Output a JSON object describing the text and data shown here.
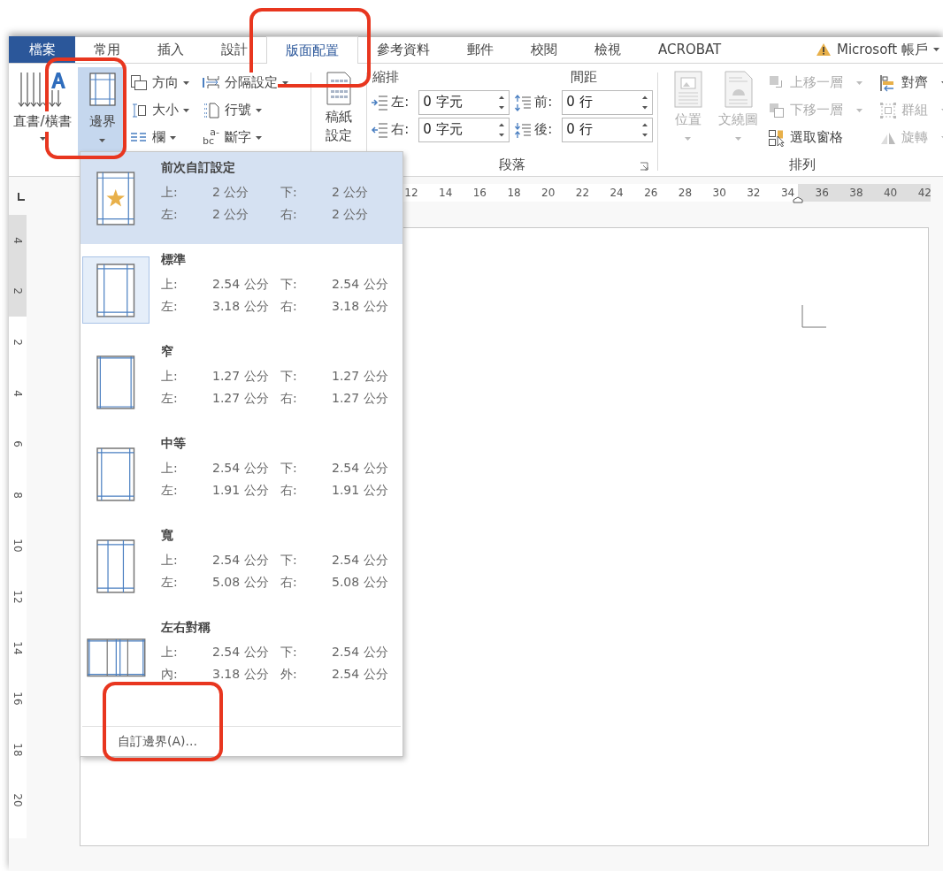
{
  "tabs": [
    {
      "label": "檔案",
      "kind": "file",
      "selected": false
    },
    {
      "label": "常用",
      "kind": "normal",
      "selected": false
    },
    {
      "label": "插入",
      "kind": "normal",
      "selected": false
    },
    {
      "label": "設計",
      "kind": "normal",
      "selected": false
    },
    {
      "label": "版面配置",
      "kind": "normal",
      "selected": true
    },
    {
      "label": "參考資料",
      "kind": "normal",
      "selected": false
    },
    {
      "label": "郵件",
      "kind": "normal",
      "selected": false
    },
    {
      "label": "校閱",
      "kind": "normal",
      "selected": false
    },
    {
      "label": "檢視",
      "kind": "normal",
      "selected": false
    },
    {
      "label": "ACROBAT",
      "kind": "normal",
      "selected": false
    }
  ],
  "account": "Microsoft 帳戶",
  "page_setup": {
    "text_direction": "直書/橫書",
    "margins": {
      "label": "邊界",
      "active": true
    },
    "column_1": [
      {
        "label": "方向",
        "kind": "orientation"
      },
      {
        "label": "大小",
        "kind": "size"
      },
      {
        "label": "欄",
        "kind": "columns"
      }
    ],
    "column_2": [
      {
        "label": "分隔設定",
        "kind": "breaks"
      },
      {
        "label": "行號",
        "kind": "line-numbers"
      },
      {
        "label": "斷字",
        "kind": "hyphenation",
        "icon_top": "a-",
        "icon_bottom": "bc"
      }
    ],
    "manuscript": "稿紙設定"
  },
  "paragraph": {
    "indent_label": "縮排",
    "spacing_label": "間距",
    "group_label": "段落",
    "indent": [
      {
        "label": "左:",
        "value": "0 字元",
        "kind": "left"
      },
      {
        "label": "右:",
        "value": "0 字元",
        "kind": "right"
      }
    ],
    "spacing": [
      {
        "label": "前:",
        "value": "0 行",
        "kind": "before"
      },
      {
        "label": "後:",
        "value": "0 行",
        "kind": "after"
      }
    ]
  },
  "arrange": {
    "group_label": "排列",
    "large": [
      {
        "label": "位置",
        "kind": "position",
        "disabled": true
      },
      {
        "label": "文繞圖",
        "kind": "wrap",
        "disabled": true
      }
    ],
    "column_1": [
      {
        "label": "上移一層",
        "kind": "forward",
        "disabled": true,
        "dropdown": true
      },
      {
        "label": "下移一層",
        "kind": "backward",
        "disabled": true,
        "dropdown": true
      },
      {
        "label": "選取窗格",
        "kind": "pane",
        "disabled": false,
        "dropdown": false
      }
    ],
    "column_2": [
      {
        "label": "對齊",
        "kind": "align",
        "disabled": false,
        "dropdown": true
      },
      {
        "label": "群組",
        "kind": "group",
        "disabled": true,
        "dropdown": true
      },
      {
        "label": "旋轉",
        "kind": "rotate",
        "disabled": true,
        "dropdown": true
      }
    ]
  },
  "horizontal_ruler": [
    "12",
    "14",
    "16",
    "18",
    "20",
    "22",
    "24",
    "26",
    "28",
    "30",
    "32",
    "34",
    "36",
    "38",
    "40",
    "42"
  ],
  "vertical_ruler": [
    "4",
    "2",
    "2",
    "4",
    "6",
    "8",
    "10",
    "12",
    "14",
    "16",
    "18",
    "20"
  ],
  "margins_menu": {
    "items": [
      {
        "title": "前次自訂設定",
        "kind": "custom",
        "selected": true,
        "focused": false,
        "rows": [
          [
            "上:",
            "2 公分",
            "下:",
            "2 公分"
          ],
          [
            "左:",
            "2 公分",
            "右:",
            "2 公分"
          ]
        ]
      },
      {
        "title": "標準",
        "kind": "normal",
        "selected": false,
        "focused": true,
        "rows": [
          [
            "上:",
            "2.54 公分",
            "下:",
            "2.54 公分"
          ],
          [
            "左:",
            "3.18 公分",
            "右:",
            "3.18 公分"
          ]
        ]
      },
      {
        "title": "窄",
        "kind": "narrow",
        "selected": false,
        "focused": false,
        "rows": [
          [
            "上:",
            "1.27 公分",
            "下:",
            "1.27 公分"
          ],
          [
            "左:",
            "1.27 公分",
            "右:",
            "1.27 公分"
          ]
        ]
      },
      {
        "title": "中等",
        "kind": "moderate",
        "selected": false,
        "focused": false,
        "rows": [
          [
            "上:",
            "2.54 公分",
            "下:",
            "2.54 公分"
          ],
          [
            "左:",
            "1.91 公分",
            "右:",
            "1.91 公分"
          ]
        ]
      },
      {
        "title": "寬",
        "kind": "wide",
        "selected": false,
        "focused": false,
        "rows": [
          [
            "上:",
            "2.54 公分",
            "下:",
            "2.54 公分"
          ],
          [
            "左:",
            "5.08 公分",
            "右:",
            "5.08 公分"
          ]
        ]
      },
      {
        "title": "左右對稱",
        "kind": "mirrored",
        "selected": false,
        "focused": false,
        "rows": [
          [
            "上:",
            "2.54 公分",
            "下:",
            "2.54 公分"
          ],
          [
            "內:",
            "3.18 公分",
            "外:",
            "2.54 公分"
          ]
        ]
      }
    ],
    "footer": "自訂邊界(A)..."
  }
}
